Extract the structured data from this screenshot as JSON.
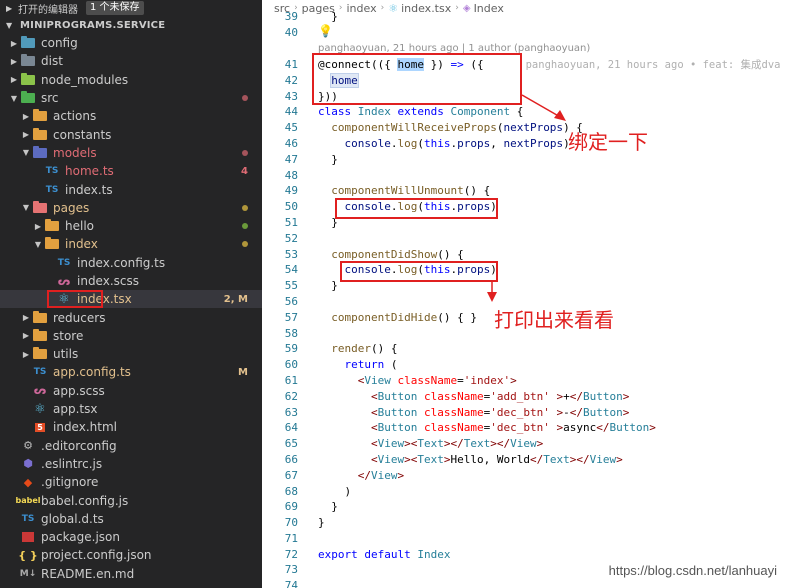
{
  "open_editors": {
    "label": "打开的编辑器",
    "unsaved": "1 个未保存"
  },
  "explorer": {
    "project": "MINIPROGRAMS.SERVICE",
    "items": [
      {
        "label": "config",
        "indent": 1,
        "kind": "folder",
        "color": "#519aba",
        "arrow": "right"
      },
      {
        "label": "dist",
        "indent": 1,
        "kind": "folder",
        "color": "#7a8793",
        "arrow": "right"
      },
      {
        "label": "node_modules",
        "indent": 1,
        "kind": "folder",
        "color": "#8bc34a",
        "arrow": "right"
      },
      {
        "label": "src",
        "indent": 1,
        "kind": "folder",
        "color": "#4caf50",
        "arrow": "down",
        "status": "dot-err"
      },
      {
        "label": "actions",
        "indent": 2,
        "kind": "folder",
        "color": "#e2a03f",
        "arrow": "right"
      },
      {
        "label": "constants",
        "indent": 2,
        "kind": "folder",
        "color": "#e2a03f",
        "arrow": "right"
      },
      {
        "label": "models",
        "indent": 2,
        "kind": "folder",
        "color": "#5c6bc0",
        "arrow": "down",
        "status": "dot-err",
        "text_class": "err"
      },
      {
        "label": "home.ts",
        "indent": 3,
        "kind": "ts",
        "badge": "4",
        "text_class": "err"
      },
      {
        "label": "index.ts",
        "indent": 3,
        "kind": "ts"
      },
      {
        "label": "pages",
        "indent": 2,
        "kind": "folder",
        "color": "#e57373",
        "arrow": "down",
        "status": "dot-mod",
        "text_class": "mod"
      },
      {
        "label": "hello",
        "indent": 3,
        "kind": "folder",
        "color": "#e2a03f",
        "arrow": "right",
        "status": "dot-green"
      },
      {
        "label": "index",
        "indent": 3,
        "kind": "folder",
        "color": "#e2a03f",
        "arrow": "down",
        "status": "dot-mod",
        "text_class": "mod"
      },
      {
        "label": "index.config.ts",
        "indent": 4,
        "kind": "ts"
      },
      {
        "label": "index.scss",
        "indent": 4,
        "kind": "scss"
      },
      {
        "label": "index.tsx",
        "indent": 4,
        "kind": "react",
        "badge": "2, M",
        "text_class": "mod",
        "selected": true
      },
      {
        "label": "reducers",
        "indent": 2,
        "kind": "folder",
        "color": "#e2a03f",
        "arrow": "right"
      },
      {
        "label": "store",
        "indent": 2,
        "kind": "folder",
        "color": "#e2a03f",
        "arrow": "right"
      },
      {
        "label": "utils",
        "indent": 2,
        "kind": "folder",
        "color": "#e2a03f",
        "arrow": "right"
      },
      {
        "label": "app.config.ts",
        "indent": 2,
        "kind": "ts",
        "badge": "M",
        "text_class": "mod"
      },
      {
        "label": "app.scss",
        "indent": 2,
        "kind": "scss"
      },
      {
        "label": "app.tsx",
        "indent": 2,
        "kind": "react"
      },
      {
        "label": "index.html",
        "indent": 2,
        "kind": "html"
      },
      {
        "label": ".editorconfig",
        "indent": 1,
        "kind": "gear"
      },
      {
        "label": ".eslintrc.js",
        "indent": 1,
        "kind": "eslint"
      },
      {
        "label": ".gitignore",
        "indent": 1,
        "kind": "git"
      },
      {
        "label": "babel.config.js",
        "indent": 1,
        "kind": "babel"
      },
      {
        "label": "global.d.ts",
        "indent": 1,
        "kind": "ts"
      },
      {
        "label": "package.json",
        "indent": 1,
        "kind": "npm"
      },
      {
        "label": "project.config.json",
        "indent": 1,
        "kind": "json"
      },
      {
        "label": "README.en.md",
        "indent": 1,
        "kind": "md"
      }
    ]
  },
  "breadcrumb": [
    "src",
    "pages",
    "index",
    "index.tsx",
    "Index"
  ],
  "code": {
    "line39": "}",
    "codelens": "panghaoyuan, 21 hours ago | 1 author (panghaoyuan)",
    "blame": "panghaoyuan, 21 hours ago • feat: 集成dva",
    "lines": [
      {
        "n": "39",
        "html": "<span>  }</span>"
      },
      {
        "n": "40",
        "html": ""
      },
      {
        "lens": true
      },
      {
        "n": "41",
        "html": "@connect(({ <span class='hl-sel'>home</span> }) <span class='kw'>=&gt;</span> ({",
        "blame": true
      },
      {
        "n": "42",
        "html": "  <span class='hl-word var'>home</span>"
      },
      {
        "n": "43",
        "html": "}))"
      },
      {
        "n": "44",
        "html": "<span class='kw'>class</span> <span class='cls'>Index</span> <span class='kw'>extends</span> <span class='cls'>Component</span> {"
      },
      {
        "n": "45",
        "html": "  <span class='fn'>componentWillReceiveProps</span>(<span class='var'>nextProps</span>) {"
      },
      {
        "n": "46",
        "html": "    <span class='var'>console</span>.<span class='fn'>log</span>(<span class='kw'>this</span>.<span class='var'>props</span>, <span class='var'>nextProps</span>)"
      },
      {
        "n": "47",
        "html": "  }"
      },
      {
        "n": "48",
        "html": ""
      },
      {
        "n": "49",
        "html": "  <span class='fn'>componentWillUnmount</span>() {"
      },
      {
        "n": "50",
        "html": "    <span class='var'>console</span>.<span class='fn'>log</span>(<span class='kw'>this</span>.<span class='var'>props</span>)"
      },
      {
        "n": "51",
        "html": "  }"
      },
      {
        "n": "52",
        "html": ""
      },
      {
        "n": "53",
        "html": "  <span class='fn'>componentDidShow</span>() {"
      },
      {
        "n": "54",
        "html": "    <span class='var'>console</span>.<span class='fn'>log</span>(<span class='kw'>this</span>.<span class='var'>props</span>)"
      },
      {
        "n": "55",
        "html": "  }"
      },
      {
        "n": "56",
        "html": ""
      },
      {
        "n": "57",
        "html": "  <span class='fn'>componentDidHide</span>() { }"
      },
      {
        "n": "58",
        "html": ""
      },
      {
        "n": "59",
        "html": "  <span class='fn'>render</span>() {"
      },
      {
        "n": "60",
        "html": "    <span class='kw'>return</span> ("
      },
      {
        "n": "61",
        "html": "      <span class='tag'>&lt;</span><span class='cls'>View</span> <span class='attr'>className</span>=<span class='str'>'index'</span><span class='tag'>&gt;</span>"
      },
      {
        "n": "62",
        "html": "        <span class='tag'>&lt;</span><span class='cls'>Button</span> <span class='attr'>className</span>=<span class='str'>'add_btn'</span> <span class='tag'>&gt;</span>+<span class='tag'>&lt;/</span><span class='cls'>Button</span><span class='tag'>&gt;</span>"
      },
      {
        "n": "63",
        "html": "        <span class='tag'>&lt;</span><span class='cls'>Button</span> <span class='attr'>className</span>=<span class='str'>'dec_btn'</span> <span class='tag'>&gt;</span>-<span class='tag'>&lt;/</span><span class='cls'>Button</span><span class='tag'>&gt;</span>"
      },
      {
        "n": "64",
        "html": "        <span class='tag'>&lt;</span><span class='cls'>Button</span> <span class='attr'>className</span>=<span class='str'>'dec_btn'</span> <span class='tag'>&gt;</span>async<span class='tag'>&lt;/</span><span class='cls'>Button</span><span class='tag'>&gt;</span>"
      },
      {
        "n": "65",
        "html": "        <span class='tag'>&lt;</span><span class='cls'>View</span><span class='tag'>&gt;&lt;</span><span class='cls'>Text</span><span class='tag'>&gt;&lt;/</span><span class='cls'>Text</span><span class='tag'>&gt;&lt;/</span><span class='cls'>View</span><span class='tag'>&gt;</span>"
      },
      {
        "n": "66",
        "html": "        <span class='tag'>&lt;</span><span class='cls'>View</span><span class='tag'>&gt;&lt;</span><span class='cls'>Text</span><span class='tag'>&gt;</span>Hello, World<span class='tag'>&lt;/</span><span class='cls'>Text</span><span class='tag'>&gt;&lt;/</span><span class='cls'>View</span><span class='tag'>&gt;</span>"
      },
      {
        "n": "67",
        "html": "      <span class='tag'>&lt;/</span><span class='cls'>View</span><span class='tag'>&gt;</span>"
      },
      {
        "n": "68",
        "html": "    )"
      },
      {
        "n": "69",
        "html": "  }"
      },
      {
        "n": "70",
        "html": "}"
      },
      {
        "n": "71",
        "html": ""
      },
      {
        "n": "72",
        "html": "<span class='kw'>export</span> <span class='kw'>default</span> <span class='cls'>Index</span>"
      },
      {
        "n": "73",
        "html": ""
      },
      {
        "n": "74",
        "html": ""
      }
    ]
  },
  "annotations": {
    "bind": "绑定一下",
    "print": "打印出来看看"
  },
  "watermark": "https://blog.csdn.net/lanhuayi",
  "colors": {
    "sidebar_bg": "#252526",
    "editor_bg": "#ffffff",
    "annotation_red": "#e02020",
    "modified": "#e2c08d",
    "error": "#e06c75"
  }
}
